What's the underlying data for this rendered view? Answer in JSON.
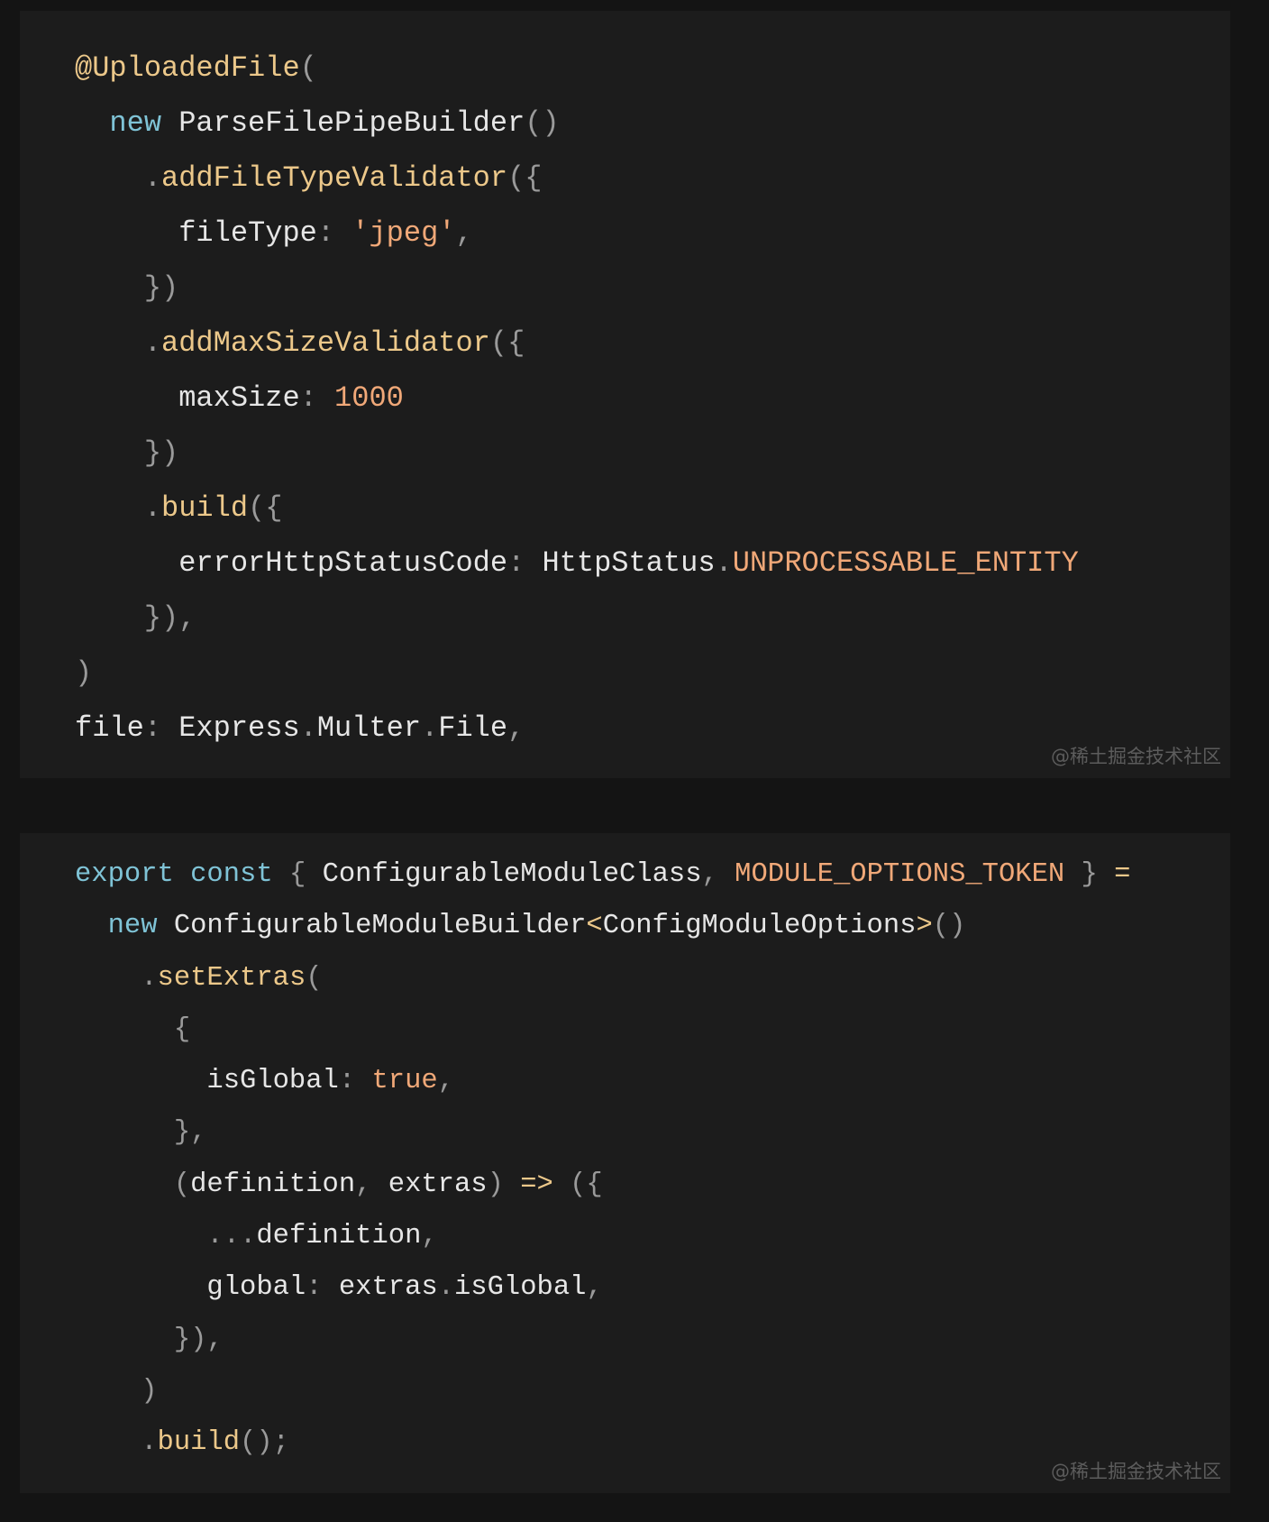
{
  "colors": {
    "background": "#141414",
    "block": "#1c1c1c",
    "text": "#e6e6e6",
    "keyword": "#7fc3d6",
    "method": "#ecc88a",
    "literal": "#f0a878",
    "punct": "#9a9a9a"
  },
  "blocks": [
    {
      "watermark": "@稀土掘金技术社区",
      "lines": [
        {
          "indent": 0,
          "tokens": [
            {
              "t": "@UploadedFile",
              "c": "y"
            },
            {
              "t": "(",
              "c": "p"
            }
          ]
        },
        {
          "indent": 1,
          "tokens": [
            {
              "t": "new ",
              "c": "k"
            },
            {
              "t": "ParseFilePipeBuilder",
              "c": "w"
            },
            {
              "t": "()",
              "c": "p"
            }
          ]
        },
        {
          "indent": 2,
          "tokens": [
            {
              "t": ".",
              "c": "p"
            },
            {
              "t": "addFileTypeValidator",
              "c": "y"
            },
            {
              "t": "({",
              "c": "p"
            }
          ]
        },
        {
          "indent": 3,
          "tokens": [
            {
              "t": "fileType",
              "c": "w"
            },
            {
              "t": ": ",
              "c": "p"
            },
            {
              "t": "'jpeg'",
              "c": "o"
            },
            {
              "t": ",",
              "c": "p"
            }
          ]
        },
        {
          "indent": 2,
          "tokens": [
            {
              "t": "})",
              "c": "p"
            }
          ]
        },
        {
          "indent": 2,
          "tokens": [
            {
              "t": ".",
              "c": "p"
            },
            {
              "t": "addMaxSizeValidator",
              "c": "y"
            },
            {
              "t": "({",
              "c": "p"
            }
          ]
        },
        {
          "indent": 3,
          "tokens": [
            {
              "t": "maxSize",
              "c": "w"
            },
            {
              "t": ": ",
              "c": "p"
            },
            {
              "t": "1000",
              "c": "o"
            }
          ]
        },
        {
          "indent": 2,
          "tokens": [
            {
              "t": "})",
              "c": "p"
            }
          ]
        },
        {
          "indent": 2,
          "tokens": [
            {
              "t": ".",
              "c": "p"
            },
            {
              "t": "build",
              "c": "y"
            },
            {
              "t": "({",
              "c": "p"
            }
          ]
        },
        {
          "indent": 3,
          "tokens": [
            {
              "t": "errorHttpStatusCode",
              "c": "w"
            },
            {
              "t": ": ",
              "c": "p"
            },
            {
              "t": "HttpStatus",
              "c": "w"
            },
            {
              "t": ".",
              "c": "p"
            },
            {
              "t": "UNPROCESSABLE_ENTITY",
              "c": "o"
            }
          ]
        },
        {
          "indent": 2,
          "tokens": [
            {
              "t": "}),",
              "c": "p"
            }
          ]
        },
        {
          "indent": 0,
          "tokens": [
            {
              "t": ")",
              "c": "p"
            }
          ]
        },
        {
          "indent": 0,
          "tokens": [
            {
              "t": "file",
              "c": "w"
            },
            {
              "t": ": ",
              "c": "p"
            },
            {
              "t": "Express",
              "c": "w"
            },
            {
              "t": ".",
              "c": "p"
            },
            {
              "t": "Multer",
              "c": "w"
            },
            {
              "t": ".",
              "c": "p"
            },
            {
              "t": "File",
              "c": "w"
            },
            {
              "t": ",",
              "c": "p"
            }
          ]
        }
      ]
    },
    {
      "watermark": "@稀土掘金技术社区",
      "lines": [
        {
          "indent": 0,
          "tokens": [
            {
              "t": "export const ",
              "c": "k"
            },
            {
              "t": "{ ",
              "c": "p"
            },
            {
              "t": "ConfigurableModuleClass",
              "c": "w"
            },
            {
              "t": ", ",
              "c": "p"
            },
            {
              "t": "MODULE_OPTIONS_TOKEN",
              "c": "o"
            },
            {
              "t": " } ",
              "c": "p"
            },
            {
              "t": "=",
              "c": "y"
            }
          ]
        },
        {
          "indent": 1,
          "tokens": [
            {
              "t": "new ",
              "c": "k"
            },
            {
              "t": "ConfigurableModuleBuilder",
              "c": "w"
            },
            {
              "t": "<",
              "c": "y"
            },
            {
              "t": "ConfigModuleOptions",
              "c": "w"
            },
            {
              "t": ">",
              "c": "y"
            },
            {
              "t": "()",
              "c": "p"
            }
          ]
        },
        {
          "indent": 2,
          "tokens": [
            {
              "t": ".",
              "c": "p"
            },
            {
              "t": "setExtras",
              "c": "y"
            },
            {
              "t": "(",
              "c": "p"
            }
          ]
        },
        {
          "indent": 3,
          "tokens": [
            {
              "t": "{",
              "c": "p"
            }
          ]
        },
        {
          "indent": 4,
          "tokens": [
            {
              "t": "isGlobal",
              "c": "w"
            },
            {
              "t": ": ",
              "c": "p"
            },
            {
              "t": "true",
              "c": "o"
            },
            {
              "t": ",",
              "c": "p"
            }
          ]
        },
        {
          "indent": 3,
          "tokens": [
            {
              "t": "},",
              "c": "p"
            }
          ]
        },
        {
          "indent": 3,
          "tokens": [
            {
              "t": "(",
              "c": "p"
            },
            {
              "t": "definition",
              "c": "w"
            },
            {
              "t": ", ",
              "c": "p"
            },
            {
              "t": "extras",
              "c": "w"
            },
            {
              "t": ") ",
              "c": "p"
            },
            {
              "t": "=>",
              "c": "y"
            },
            {
              "t": " ({",
              "c": "p"
            }
          ]
        },
        {
          "indent": 4,
          "tokens": [
            {
              "t": "...",
              "c": "p"
            },
            {
              "t": "definition",
              "c": "w"
            },
            {
              "t": ",",
              "c": "p"
            }
          ]
        },
        {
          "indent": 4,
          "tokens": [
            {
              "t": "global",
              "c": "w"
            },
            {
              "t": ": ",
              "c": "p"
            },
            {
              "t": "extras",
              "c": "w"
            },
            {
              "t": ".",
              "c": "p"
            },
            {
              "t": "isGlobal",
              "c": "w"
            },
            {
              "t": ",",
              "c": "p"
            }
          ]
        },
        {
          "indent": 3,
          "tokens": [
            {
              "t": "}),",
              "c": "p"
            }
          ]
        },
        {
          "indent": 2,
          "tokens": [
            {
              "t": ")",
              "c": "p"
            }
          ]
        },
        {
          "indent": 2,
          "tokens": [
            {
              "t": ".",
              "c": "p"
            },
            {
              "t": "build",
              "c": "y"
            },
            {
              "t": "();",
              "c": "p"
            }
          ]
        }
      ]
    }
  ]
}
